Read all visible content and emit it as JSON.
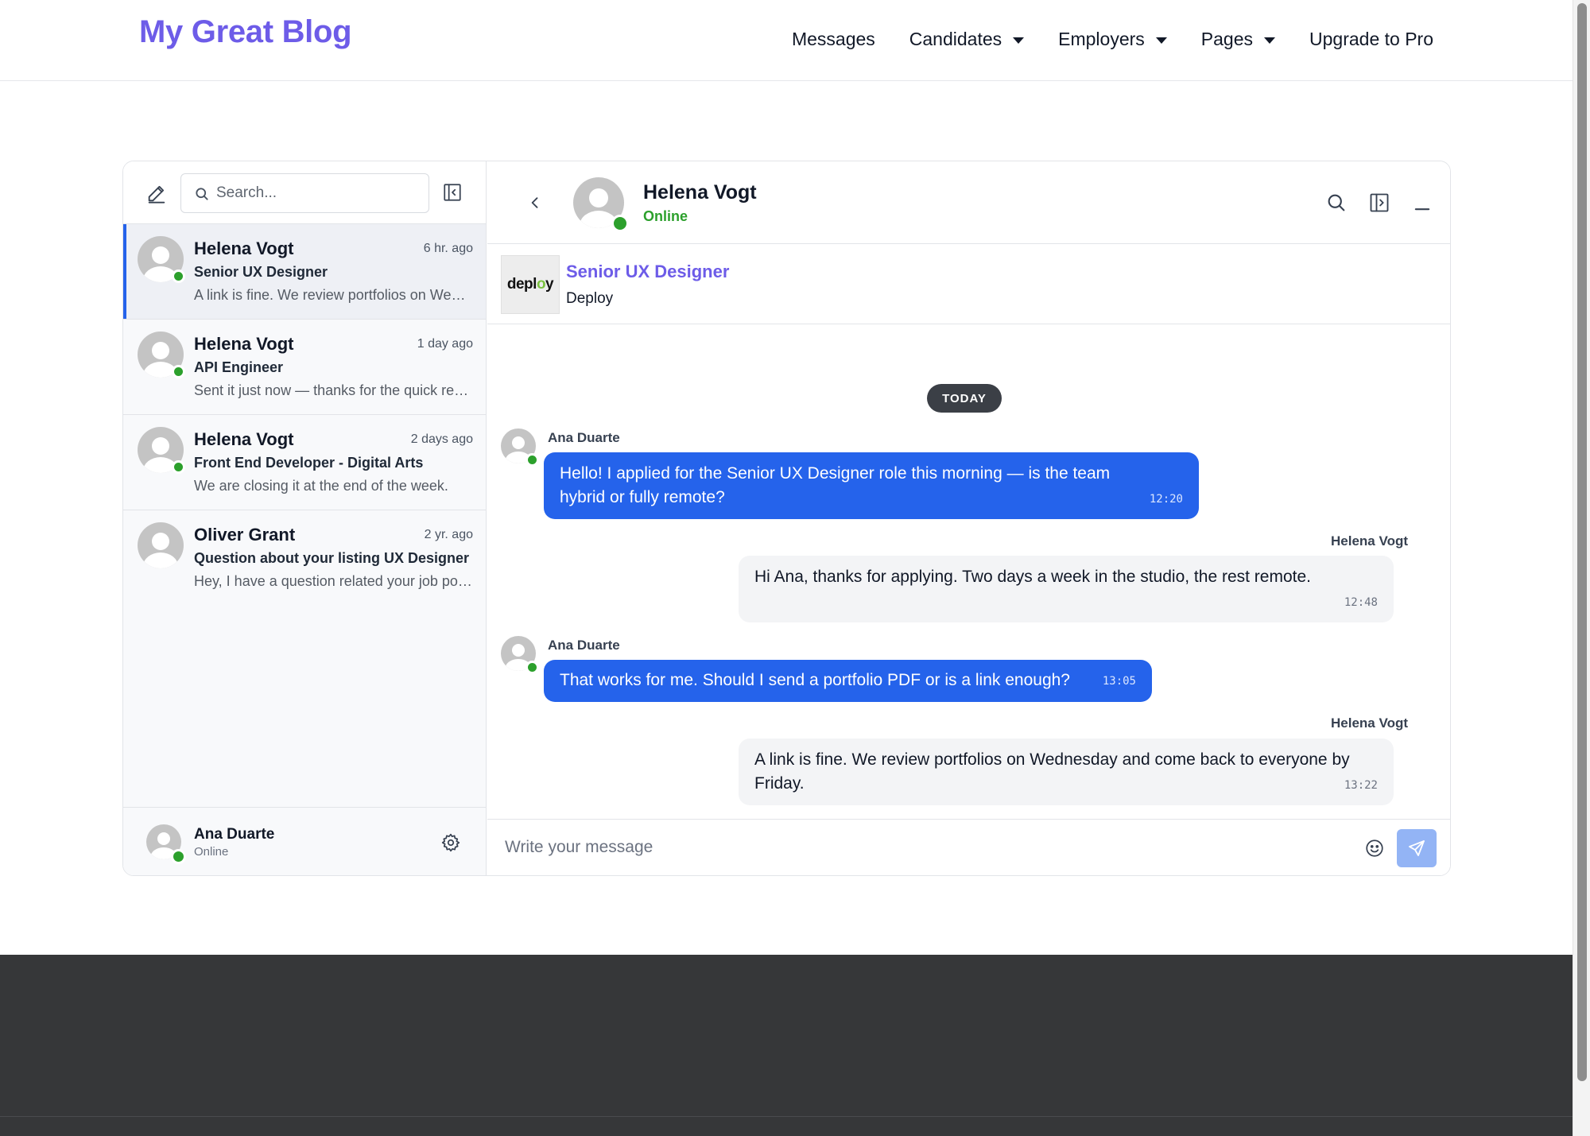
{
  "brand": {
    "title": "My Great Blog"
  },
  "nav": {
    "items": [
      {
        "label": "Messages",
        "dropdown": false
      },
      {
        "label": "Candidates",
        "dropdown": true
      },
      {
        "label": "Employers",
        "dropdown": true
      },
      {
        "label": "Pages",
        "dropdown": true
      },
      {
        "label": "Upgrade to Pro",
        "dropdown": false
      }
    ]
  },
  "sidebar": {
    "search_placeholder": "Search...",
    "conversations": [
      {
        "name": "Helena Vogt",
        "time": "6 hr. ago",
        "subject": "Senior UX Designer",
        "preview": "A link is fine. We review portfolios on Wednesday and come back to everyone by Friday.",
        "online": true,
        "active": true
      },
      {
        "name": "Helena Vogt",
        "time": "1 day ago",
        "subject": "API Engineer",
        "preview": "Sent it just now — thanks for the quick reply!",
        "online": true,
        "active": false
      },
      {
        "name": "Helena Vogt",
        "time": "2 days ago",
        "subject": "Front End Developer - Digital Arts",
        "preview": "We are closing it at the end of the week.",
        "online": true,
        "active": false
      },
      {
        "name": "Oliver Grant",
        "time": "2 yr. ago",
        "subject": "Question about your listing UX Designer",
        "preview": "Hey, I have a question related your job posting.",
        "online": false,
        "active": false
      }
    ],
    "current_user": {
      "name": "Ana Duarte",
      "status": "Online"
    }
  },
  "chat": {
    "peer_name": "Helena Vogt",
    "peer_status": "Online",
    "job": {
      "title": "Senior UX Designer",
      "company": "Deploy",
      "logo_text_a": "depl",
      "logo_text_b": "o",
      "logo_text_c": "y"
    },
    "day_label": "TODAY",
    "messages": [
      {
        "sender": "Ana Duarte",
        "direction": "out",
        "text": "Hello! I applied for the Senior UX Designer role this morning — is the team hybrid or fully remote?",
        "time": "12:20"
      },
      {
        "sender": "Helena Vogt",
        "direction": "in",
        "text": "Hi Ana, thanks for applying. Two days a week in the studio, the rest remote.",
        "time": "12:48"
      },
      {
        "sender": "Ana Duarte",
        "direction": "out",
        "text": "That works for me. Should I send a portfolio PDF or is a link enough?",
        "time": "13:05"
      },
      {
        "sender": "Helena Vogt",
        "direction": "in",
        "text": "A link is fine. We review portfolios on Wednesday and come back to everyone by Friday.",
        "time": "13:22"
      }
    ],
    "composer_placeholder": "Write your message"
  },
  "colors": {
    "brand": "#6d5ce8",
    "accent": "#2563eb",
    "online": "#2ca02c",
    "send_button": "#93b4f5",
    "footer": "#363739"
  }
}
